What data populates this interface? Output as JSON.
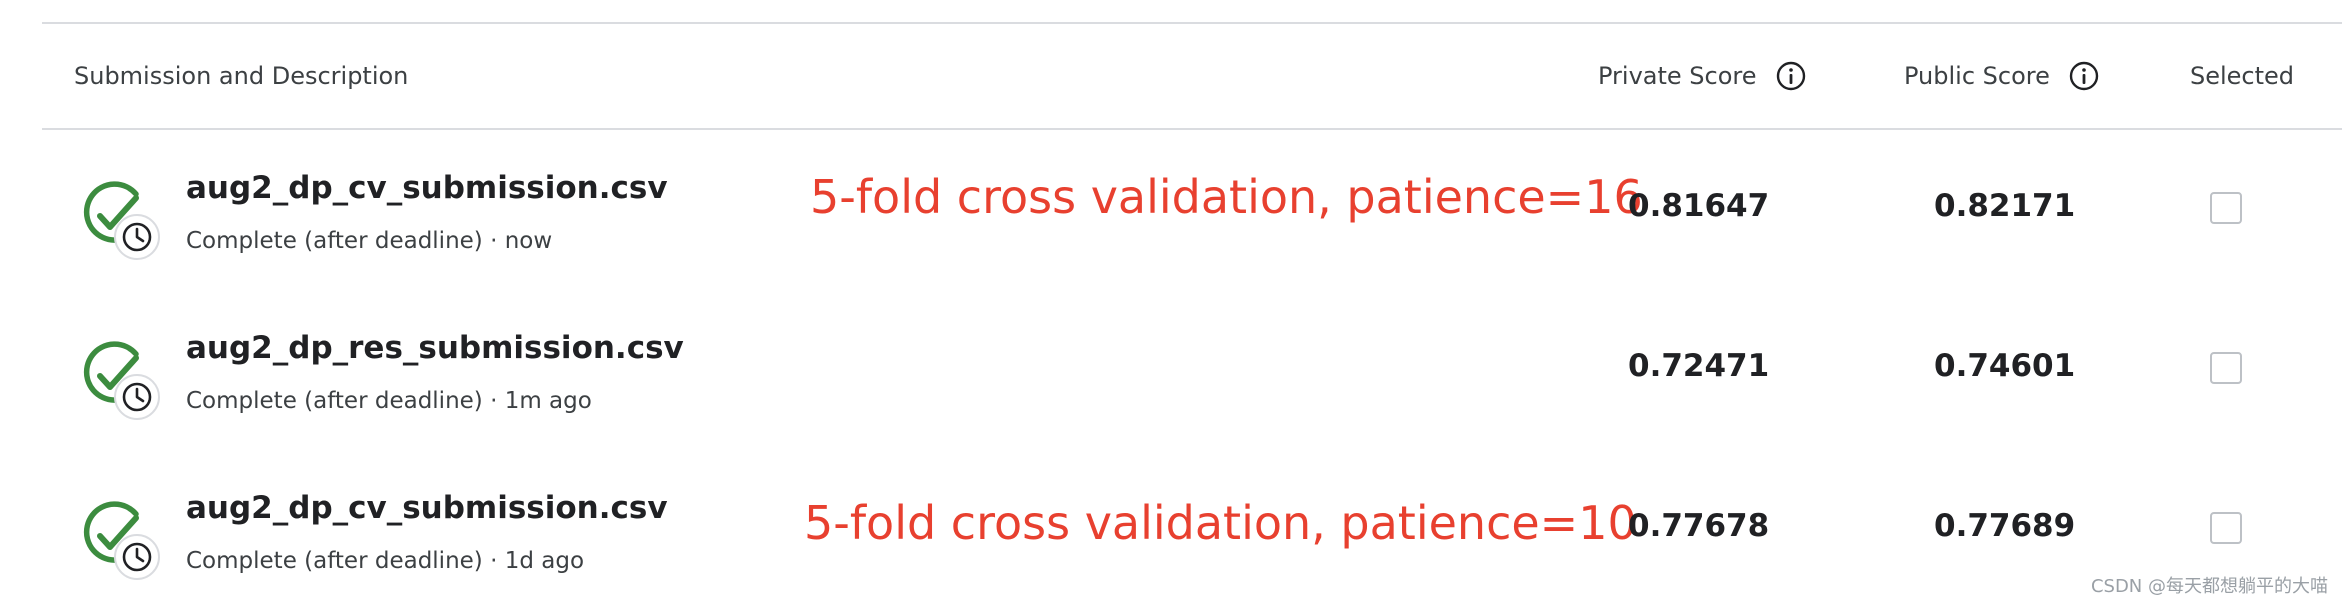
{
  "table": {
    "headers": {
      "submission": "Submission and Description",
      "private_score": "Private Score",
      "public_score": "Public Score",
      "selected": "Selected"
    },
    "rows": [
      {
        "file_name": "aug2_dp_cv_submission.csv",
        "status": "Complete (after deadline) · now",
        "annotation": "5-fold cross validation, patience=16",
        "private_score": "0.81647",
        "public_score": "0.82171",
        "selected": false
      },
      {
        "file_name": "aug2_dp_res_submission.csv",
        "status": "Complete (after deadline) · 1m ago",
        "annotation": "",
        "private_score": "0.72471",
        "public_score": "0.74601",
        "selected": false
      },
      {
        "file_name": "aug2_dp_cv_submission.csv",
        "status": "Complete (after deadline) · 1d ago",
        "annotation": "5-fold cross validation, patience=10",
        "private_score": "0.77678",
        "public_score": "0.77689",
        "selected": false
      }
    ]
  },
  "icons": {
    "status": "complete-check-clock-icon",
    "info": "info-icon"
  },
  "colors": {
    "success_green": "#3c8c3f",
    "annotation_red": "#e8402f",
    "divider": "#dadce0"
  },
  "watermark": "CSDN @每天都想躺平的大喵"
}
